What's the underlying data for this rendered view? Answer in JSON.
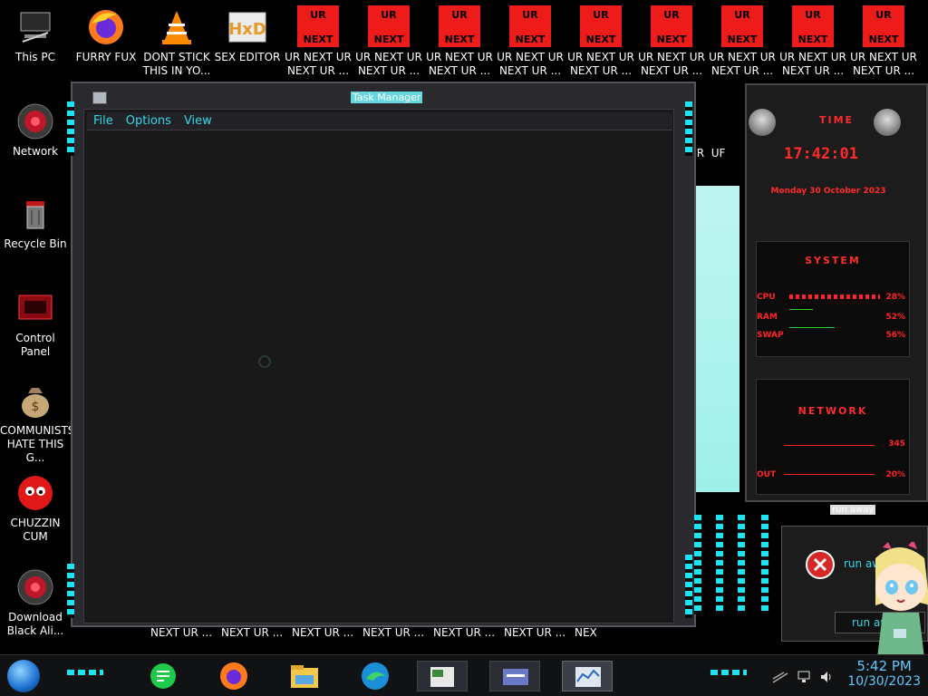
{
  "desktop": {
    "left_icons": [
      {
        "label": "This PC"
      },
      {
        "label": "Network"
      },
      {
        "label": "Recycle Bin"
      },
      {
        "label": "Control Panel"
      },
      {
        "label": "COMMUNISTS HATE THIS G..."
      },
      {
        "label": "CHUZZIN CUM"
      },
      {
        "label": "Download Black Ali..."
      }
    ],
    "top_icons": [
      {
        "label": "FURRY FUX"
      },
      {
        "label": "DONT STICK THIS IN YO..."
      },
      {
        "label": "SEX EDITOR"
      }
    ],
    "ur_icon": {
      "top_text": "UR",
      "bottom_text": "NEXT",
      "label1": "UR NEXT UR",
      "label2": "NEXT UR ..."
    },
    "bottom_row_label": "NEXT UR ...",
    "bottom_row_partial": "NEX",
    "hxd_badge": "HxD"
  },
  "task_manager": {
    "title": "Task Manager",
    "menus": [
      "File",
      "Options",
      "View"
    ]
  },
  "widget": {
    "time_title": "TIME",
    "time": "17:42:01",
    "date": "Monday 30 October 2023",
    "system_title": "SYSTEM",
    "cpu_label": "CPU",
    "cpu_value": "28%",
    "ram_label": "RAM",
    "ram_value": "52%",
    "swap_label": "SWAP",
    "swap_value": "56%",
    "network_title": "NETWORK",
    "in_value": "345",
    "out_label": "OUT",
    "out_value": "20%"
  },
  "error_dialog": {
    "title": "run away",
    "message": "run aw",
    "button": "run aw"
  },
  "taskbar": {
    "time": "5:42 PM",
    "date": "10/30/2023",
    "apps": [
      "teams-icon",
      "firefox-icon",
      "file-explorer-icon",
      "edge-icon",
      "task-manager-icon",
      "control-panel-icon",
      "performance-icon"
    ]
  },
  "colors": {
    "accent_cyan": "#33d6e6",
    "accent_red": "#ff2424",
    "desktop_bg": "#000000"
  }
}
